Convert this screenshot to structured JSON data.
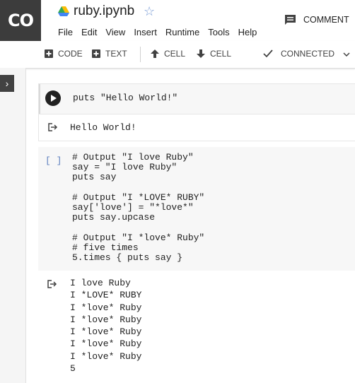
{
  "app": {
    "logo_text": "CO",
    "file_name": "ruby.ipynb"
  },
  "menu": [
    "File",
    "Edit",
    "View",
    "Insert",
    "Runtime",
    "Tools",
    "Help"
  ],
  "header": {
    "comment_label": "COMMENT"
  },
  "toolbar": {
    "add_code": "CODE",
    "add_text": "TEXT",
    "cell_up": "CELL",
    "cell_down": "CELL",
    "status": "CONNECTED"
  },
  "cells": [
    {
      "code": "puts \"Hello World!\"",
      "output": "Hello World!"
    },
    {
      "exec_marker": "[ ]",
      "code": "# Output \"I love Ruby\"\nsay = \"I love Ruby\"\nputs say\n\n# Output \"I *LOVE* RUBY\"\nsay['love'] = \"*love*\"\nputs say.upcase\n\n# Output \"I *love* Ruby\"\n# five times\n5.times { puts say }",
      "output": "I love Ruby\nI *LOVE* RUBY\nI *love* Ruby\nI *love* Ruby\nI *love* Ruby\nI *love* Ruby\nI *love* Ruby\n5"
    }
  ],
  "colors": {
    "logo_bg": "#3c3c3c",
    "star": "#7a9cd6",
    "cell_bg": "#f7f7f7"
  }
}
